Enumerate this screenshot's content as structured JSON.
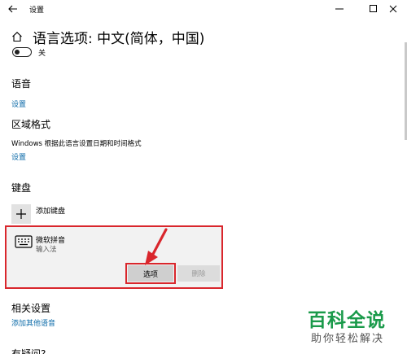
{
  "window": {
    "title": "设置",
    "minimize_glyph": "–",
    "maximize_glyph": "□",
    "close_glyph": "×"
  },
  "page": {
    "title": "语言选项: 中文(简体，中国)",
    "toggle_label": "关",
    "toggle_state": "off"
  },
  "language": {
    "heading": "语音",
    "settings_link": "设置"
  },
  "region": {
    "heading": "区域格式",
    "description": "Windows 根据此语言设置日期和时间格式",
    "settings_link": "设置"
  },
  "keyboard": {
    "heading": "键盘",
    "add_label": "添加键盘",
    "items": [
      {
        "name": "微软拼音",
        "type": "输入法",
        "options_label": "选项",
        "delete_label": "删除"
      }
    ]
  },
  "related": {
    "heading": "相关设置",
    "link": "添加其他语音"
  },
  "bottom_partial": {
    "heading": "有疑问?"
  },
  "watermark": {
    "main": "百科全说",
    "sub": "助你轻松解决"
  },
  "colors": {
    "link": "#0b6aa8",
    "highlight": "#d9262c",
    "watermark_green": "#1a9a4a"
  }
}
